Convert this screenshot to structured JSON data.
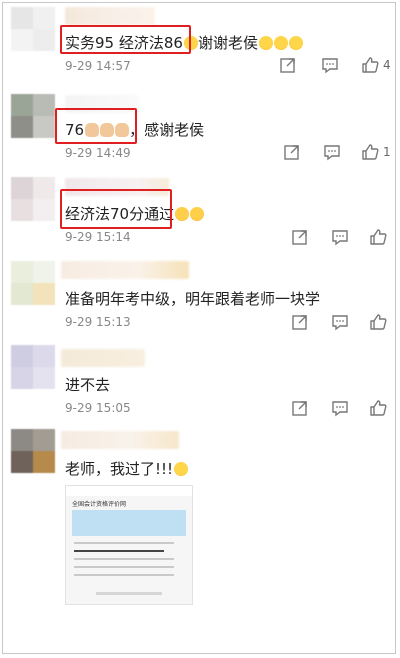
{
  "colors": {
    "highlight": "#e02020",
    "time": "#888888",
    "icon": "#777777"
  },
  "comments": [
    {
      "text": "实务95 经济法86",
      "text_suffix": "谢谢老侯",
      "time": "9-29 14:57",
      "likes": "4",
      "emojis_after": [
        "cry-emoji",
        "cry-emoji",
        "cry-emoji"
      ]
    },
    {
      "text": "76",
      "text_suffix": "，感谢老侯",
      "time": "9-29 14:49",
      "likes": "1",
      "emojis_inline": [
        "praying-hands-emoji",
        "praying-hands-emoji",
        "praying-hands-emoji"
      ]
    },
    {
      "text": "经济法70分通过",
      "time": "9-29 15:14",
      "likes": "",
      "emojis_after": [
        "sad-emoji",
        "sad-emoji"
      ]
    },
    {
      "text": "准备明年考中级，明年跟着老师一块学",
      "time": "9-29 15:13",
      "likes": ""
    },
    {
      "text": "进不去",
      "time": "9-29 15:05",
      "likes": ""
    },
    {
      "text": "老师，我过了!!!",
      "time": "",
      "likes": "",
      "emojis_after": [
        "cry-emoji"
      ],
      "attachment": {
        "title": "全国会计资格评价网"
      }
    }
  ],
  "icons": {
    "share": "share-icon",
    "comment": "comment-icon",
    "like": "thumb-up-icon"
  }
}
